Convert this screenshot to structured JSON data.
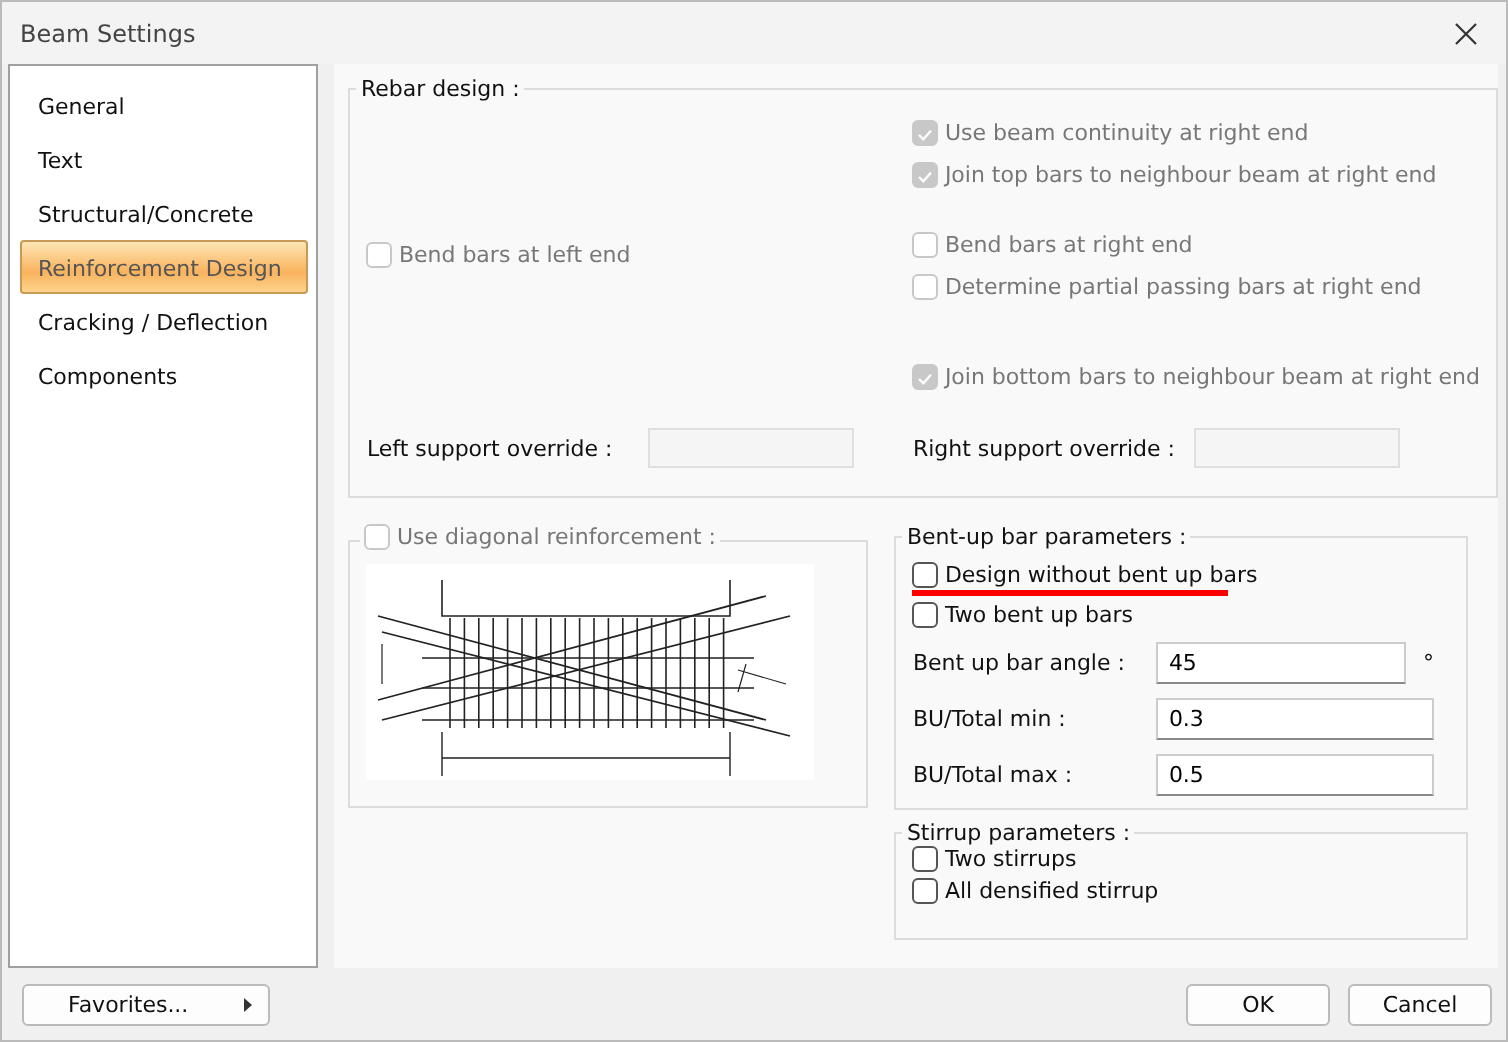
{
  "window": {
    "title": "Beam Settings"
  },
  "sidebar": {
    "items": [
      {
        "label": "General",
        "selected": false
      },
      {
        "label": "Text",
        "selected": false
      },
      {
        "label": "Structural/Concrete",
        "selected": false
      },
      {
        "label": "Reinforcement Design",
        "selected": true
      },
      {
        "label": "Cracking / Deflection",
        "selected": false
      },
      {
        "label": "Components",
        "selected": false
      }
    ]
  },
  "rebar_design": {
    "title": "Rebar design :",
    "left_checks": [
      {
        "label": "Bend bars at left end",
        "checked": false,
        "disabled": true
      }
    ],
    "right_checks": [
      {
        "label": "Use beam continuity at right end",
        "checked": true,
        "disabled": true
      },
      {
        "label": "Join top bars to neighbour beam at right end",
        "checked": true,
        "disabled": true
      },
      {
        "label": "Bend bars at right end",
        "checked": false,
        "disabled": true
      },
      {
        "label": "Determine partial passing bars at right end",
        "checked": false,
        "disabled": true
      },
      {
        "label": "Join bottom bars to neighbour beam at right end",
        "checked": true,
        "disabled": true
      }
    ],
    "overrides": [
      {
        "label": "Left support override :",
        "disabled": true
      },
      {
        "label": "Right support override :",
        "disabled": true
      }
    ]
  },
  "diagonal": {
    "label": "Use diagonal reinforcement :",
    "checked": false,
    "disabled": true
  },
  "bent_up": {
    "title": "Bent-up bar parameters :",
    "checks": [
      {
        "label": "Design without bent up bars",
        "checked": false,
        "highlighted": true
      },
      {
        "label": "Two bent up bars",
        "checked": false,
        "highlighted": false
      }
    ],
    "fields": [
      {
        "label": "Bent up bar angle :",
        "value": "45",
        "unit": "°"
      },
      {
        "label": "BU/Total min :",
        "value": "0.3"
      },
      {
        "label": "BU/Total max :",
        "value": "0.5"
      }
    ]
  },
  "stirrup": {
    "title": "Stirrup parameters :",
    "checks": [
      {
        "label": "Two stirrups",
        "checked": false
      },
      {
        "label": "All densified stirrup",
        "checked": false
      }
    ]
  },
  "footer": {
    "favorites": "Favorites...",
    "buttons": [
      "OK",
      "Cancel"
    ]
  }
}
